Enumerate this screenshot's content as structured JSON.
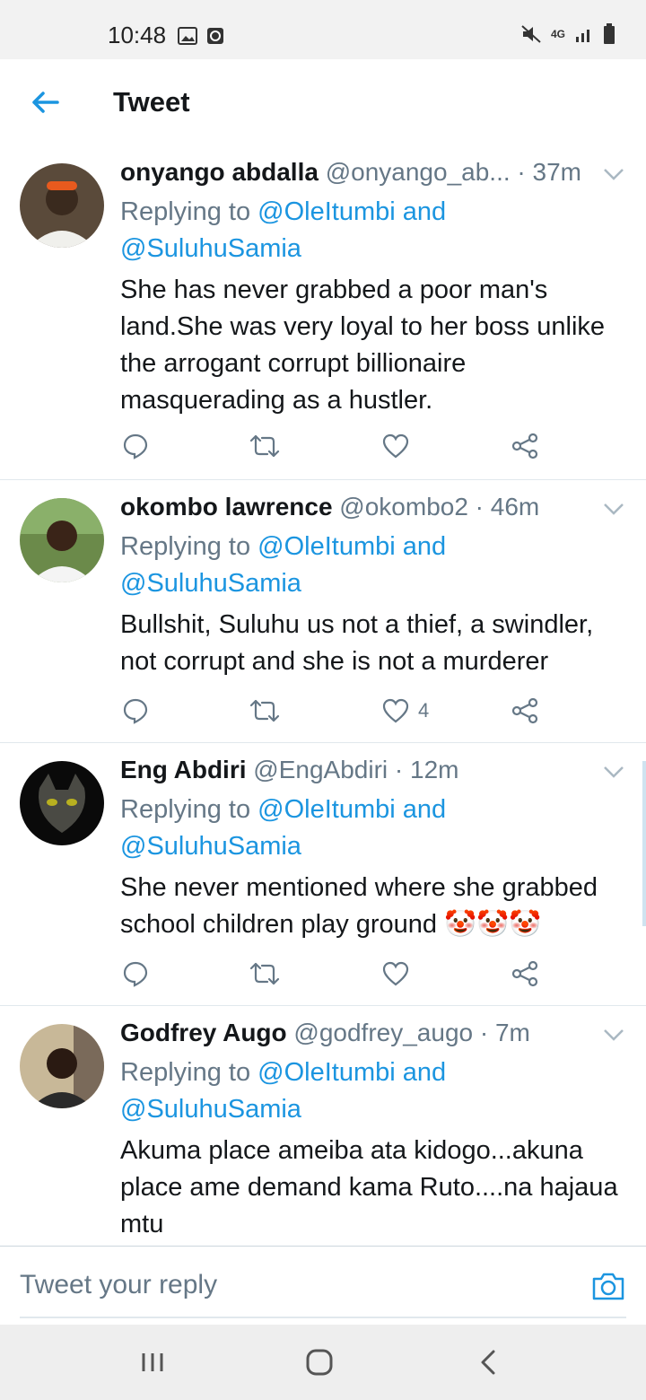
{
  "status_bar": {
    "time": "10:48",
    "network": "4G",
    "icons": [
      "image-icon",
      "clock-icon",
      "mute-icon",
      "signal-icon",
      "battery-icon"
    ]
  },
  "header": {
    "title": "Tweet",
    "back_icon": "arrow-left-icon"
  },
  "colors": {
    "accent": "#1b95e0",
    "text": "#14171a",
    "muted": "#657786",
    "divider": "#e1e8ed"
  },
  "tweets": [
    {
      "name": "onyango abdalla",
      "handle": "@onyango_ab...",
      "time": " · 37m",
      "replying_prefix": "Replying to ",
      "mention1": "@OleItumbi and",
      "mention2": "@SuluhuSamia",
      "body": "She has never grabbed a poor man's land.She was very loyal to her boss unlike the arrogant corrupt billionaire masquerading as a hustler.",
      "like_count": ""
    },
    {
      "name": "okombo lawrence",
      "handle": "@okombo2",
      "time": " · 46m",
      "replying_prefix": "Replying to ",
      "mention1": "@OleItumbi and",
      "mention2": "@SuluhuSamia",
      "body": "Bullshit, Suluhu us not a thief, a swindler, not corrupt and she is not a murderer",
      "like_count": "4"
    },
    {
      "name": "Eng Abdiri",
      "handle": "@EngAbdiri",
      "time": " · 12m",
      "replying_prefix": "Replying to ",
      "mention1": "@OleItumbi and",
      "mention2": "@SuluhuSamia",
      "body": "She never mentioned where she grabbed school children play ground 🤡🤡🤡",
      "like_count": ""
    },
    {
      "name": "Godfrey Augo",
      "handle": "@godfrey_augo",
      "time": " · 7m",
      "replying_prefix": "Replying to ",
      "mention1": "@OleItumbi and",
      "mention2": "@SuluhuSamia",
      "body": "Akuma place ameiba ata kidogo...akuna place ame demand kama Ruto....na hajaua mtu",
      "like_count": ""
    }
  ],
  "composer": {
    "placeholder": "Tweet your reply",
    "icon": "camera-icon"
  },
  "navbar": {
    "icons": [
      "recent-apps-icon",
      "home-icon",
      "back-icon"
    ]
  }
}
